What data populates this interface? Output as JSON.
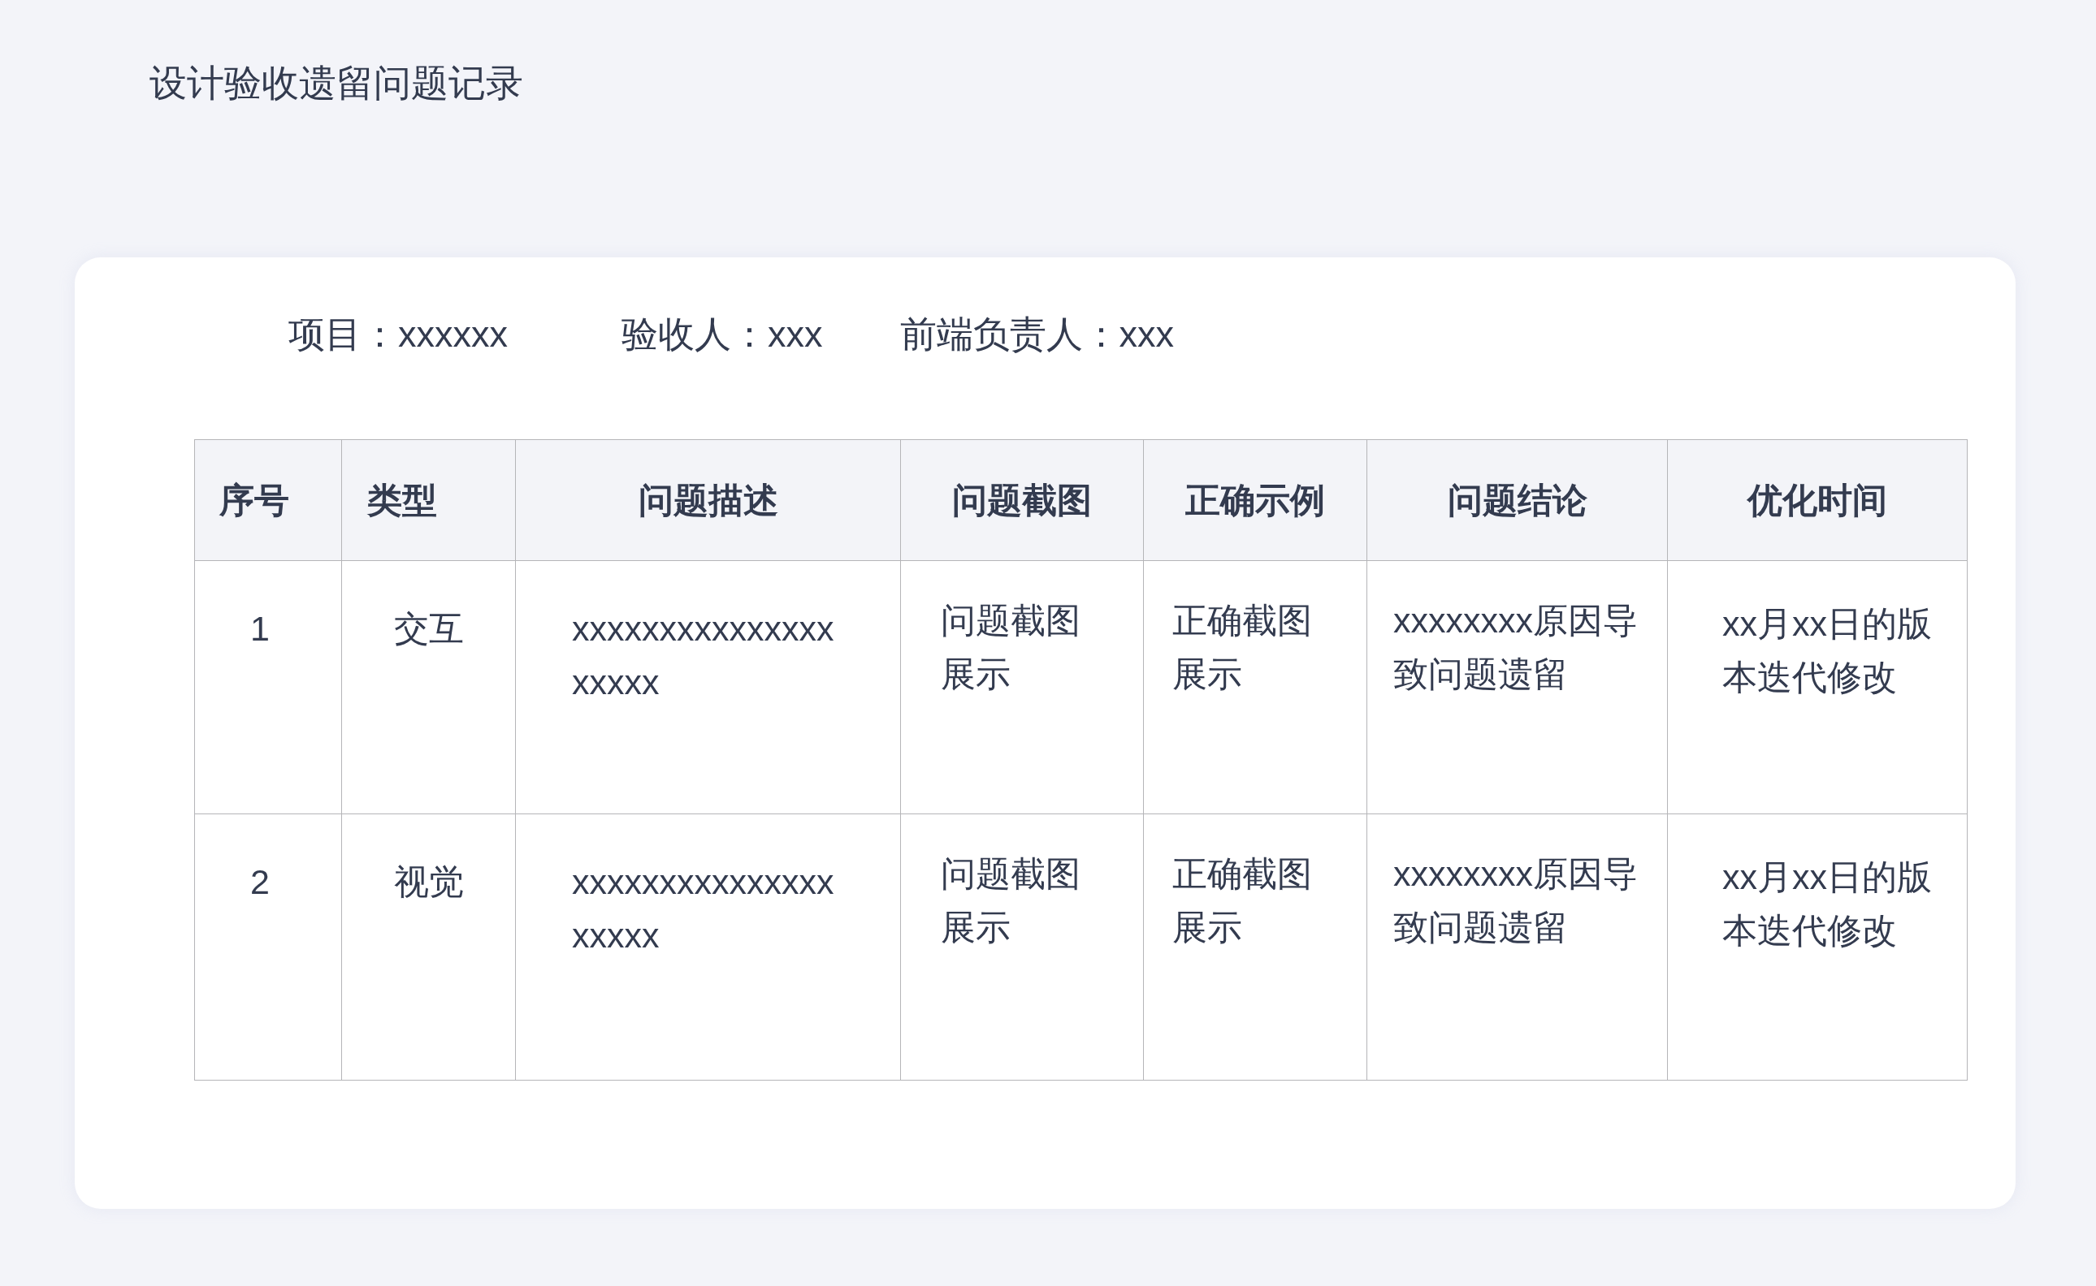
{
  "title": "设计验收遗留问题记录",
  "info": [
    "项目：xxxxxx",
    "验收人：xxx",
    "前端负责人：xxx"
  ],
  "table": {
    "columns": [
      "序号",
      "类型",
      "问题描述",
      "问题截图",
      "正确示例",
      "问题结论",
      "优化时间"
    ],
    "rows": [
      [
        "1",
        "交互",
        "xxxxxxxxxxxxxxxxxxxx",
        "问题截图展示",
        "正确截图展示",
        "xxxxxxxx原因导致问题遗留",
        "xx月xx日的版本迭代修改"
      ],
      [
        "2",
        "视觉",
        "xxxxxxxxxxxxxxxxxxxx",
        "问题截图展示",
        "正确截图展示",
        "xxxxxxxx原因导致问题遗留",
        "xx月xx日的版本迭代修改"
      ]
    ]
  }
}
